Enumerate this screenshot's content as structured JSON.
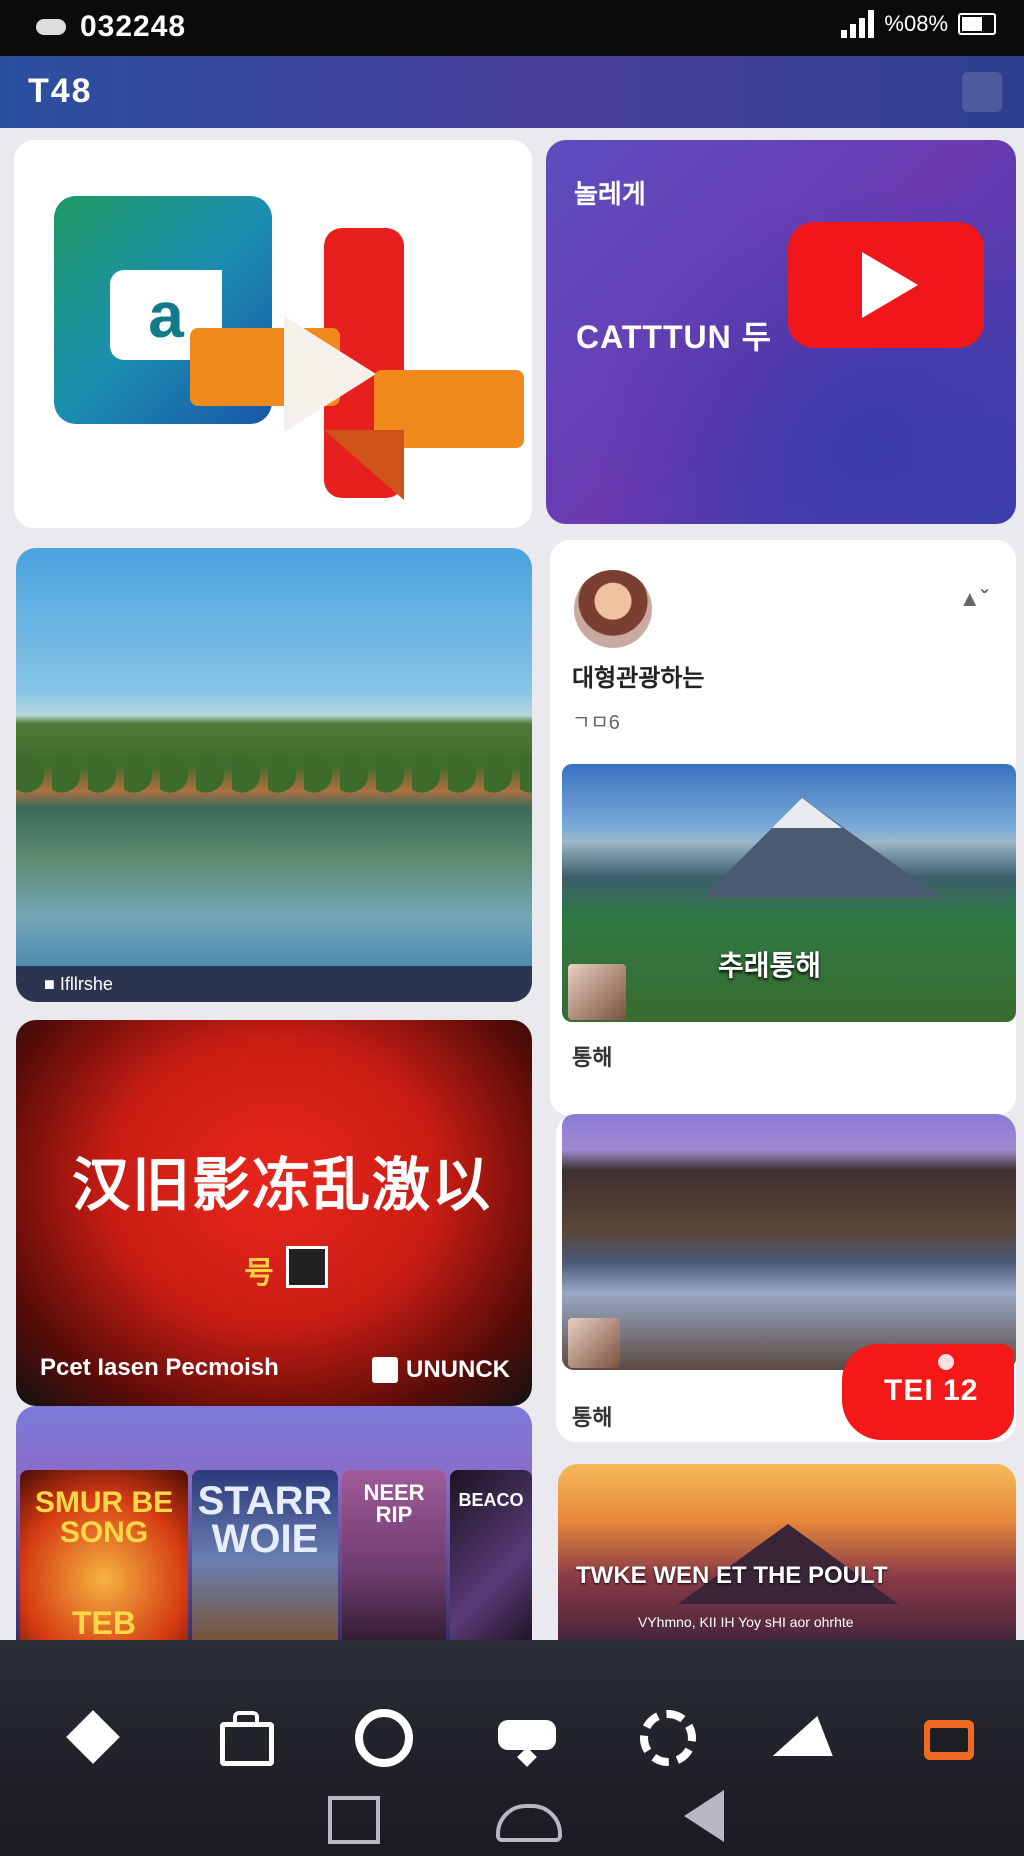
{
  "status_bar": {
    "time": "032248",
    "right_text": "%08%"
  },
  "app_bar": {
    "title": "T48"
  },
  "cards": {
    "logo_card": {
      "glyph": "a"
    },
    "youtube_card": {
      "small_title": "놀레게",
      "big_title": "CATTTUN 두"
    },
    "lake_card": {
      "caption": "■ Ifllrshe"
    },
    "poster_card": {
      "title": "汉旧影冻乱激以",
      "tag": "号",
      "footer_left": "Pcet Iasen Pecmoish",
      "footer_right": "UNUNCK"
    },
    "posters": [
      {
        "title": "SMUR BE SONG",
        "badge": "TEB"
      },
      {
        "title": "STARR WOIE"
      },
      {
        "title": "NEER RIP"
      },
      {
        "title": "BEACO"
      }
    ],
    "post_card": {
      "author": "대형관광하는",
      "meta": "ㄱㅁ6",
      "more": "▲ˇ",
      "image_overlay": "추래통해",
      "caption": "통해"
    },
    "evening_card": {
      "caption": "통해"
    },
    "badge": {
      "label": "TEI 12"
    },
    "sunset_card": {
      "title": "TWKE WEN ET THE POULT",
      "subtitle": "VYhmno, KII IH Yoy sHI aor ohrhte"
    }
  },
  "bottom_nav": {
    "items": [
      {
        "icon": "diamond-icon"
      },
      {
        "icon": "bag-icon"
      },
      {
        "icon": "circle-icon"
      },
      {
        "icon": "gamepad-icon"
      },
      {
        "icon": "gear-icon"
      },
      {
        "icon": "playstation-icon"
      },
      {
        "icon": "folder-icon",
        "active": true
      }
    ]
  },
  "colors": {
    "accent": "#f06a24",
    "youtube_red": "#f0161a",
    "appbar": "#3a4aa0"
  }
}
